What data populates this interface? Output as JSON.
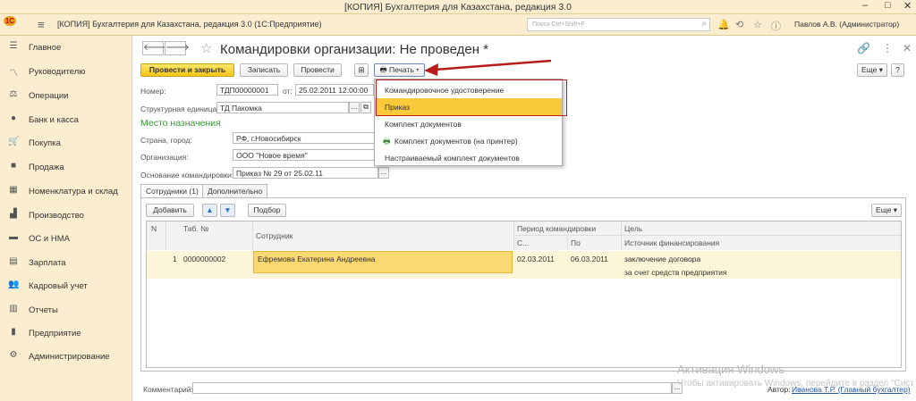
{
  "window": {
    "title": "[КОПИЯ] Бухгалтерия для Казахстана, редакция 3.0"
  },
  "appbar": {
    "title": "[КОПИЯ] Бухгалтерия для Казахстана, редакция 3.0  (1С:Предприятие)",
    "search_placeholder": "Поиск Ctrl+Shift+F",
    "user": "Павлов А.В. (Администратор)"
  },
  "sidebar": {
    "items": [
      {
        "label": "Главное",
        "icon": "menu-icon"
      },
      {
        "label": "Руководителю",
        "icon": "chart-line-icon"
      },
      {
        "label": "Операции",
        "icon": "scales-icon"
      },
      {
        "label": "Банк и касса",
        "icon": "coin-icon"
      },
      {
        "label": "Покупка",
        "icon": "cart-icon"
      },
      {
        "label": "Продажа",
        "icon": "bag-icon"
      },
      {
        "label": "Номенклатура и склад",
        "icon": "grid-icon"
      },
      {
        "label": "Производство",
        "icon": "factory-icon"
      },
      {
        "label": "ОС и НМА",
        "icon": "truck-icon"
      },
      {
        "label": "Зарплата",
        "icon": "money-icon"
      },
      {
        "label": "Кадровый учет",
        "icon": "people-icon"
      },
      {
        "label": "Отчеты",
        "icon": "report-icon"
      },
      {
        "label": "Предприятие",
        "icon": "building-icon"
      },
      {
        "label": "Администрирование",
        "icon": "gear-icon"
      }
    ]
  },
  "doc": {
    "title": "Командировки организации: Не проведен *",
    "buttons": {
      "post_close": "Провести и закрыть",
      "save": "Записать",
      "post": "Провести",
      "print": "Печать",
      "more": "Еще"
    },
    "fields": {
      "number_label": "Номер:",
      "number_value": "ТДП00000001",
      "date_label": "от:",
      "date_value": "25.02.2011 12:00:00",
      "unit_label": "Структурная единица:",
      "unit_value": "ТД Пакомка",
      "section_label": "Место назначения",
      "city_label": "Страна, город:",
      "city_value": "РФ, г.Новосибирск",
      "org_label": "Организация:",
      "org_value": "ООО \"Новое время\"",
      "basis_label": "Основание командировки:",
      "basis_value": "Приказ № 29 от 25.02.11",
      "comment_label": "Комментарий:",
      "author_label": "Автор:",
      "author_value": "Иванова Т.Р. (Главный бухгалтер)"
    },
    "tabs": [
      "Сотрудники (1)",
      "Дополнительно"
    ],
    "grid_buttons": {
      "add": "Добавить",
      "select": "Подбор",
      "more": "Еще"
    },
    "columns": {
      "n": "N",
      "tab": "Таб. №",
      "employee": "Сотрудник",
      "period": "Период командировки",
      "from": "С...",
      "to": "По",
      "goal": "Цель",
      "source": "Источник финансирования"
    },
    "rows": [
      {
        "n": "1",
        "tab": "0000000002",
        "employee": "Ефремова Екатерина Андреевна",
        "from": "02.03.2011",
        "to": "06.03.2011",
        "goal": "заключение договора",
        "source": "за счет средств предприятия"
      }
    ]
  },
  "print_menu": {
    "items": [
      "Командировочное удостоверение",
      "Приказ",
      "Комплект документов",
      "Комплект документов (на принтер)",
      "Настраиваемый комплект документов"
    ]
  },
  "watermark": {
    "line1": "Активация Windows",
    "line2": "Чтобы активировать Windows, перейдите в раздел \"Система\" компонент панели управления \"Система\""
  },
  "colors": {
    "accent_yellow": "#f8ca3a",
    "sidebar_bg": "#fbeed0",
    "section_green": "#3a9a3a",
    "highlight_red": "#b71c1c"
  }
}
